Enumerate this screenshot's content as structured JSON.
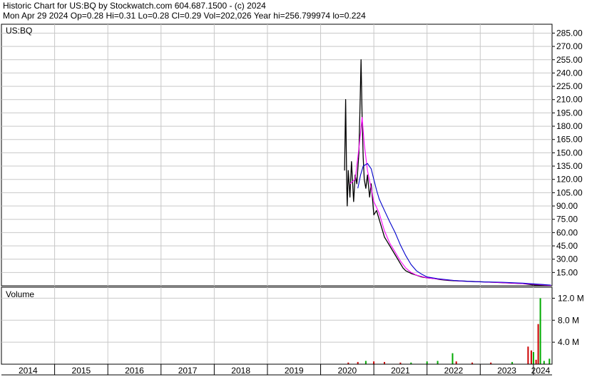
{
  "header": {
    "line1": "Historic Chart for US:BQ by Stockwatch.com 604.687.1500 - (c) 2024",
    "line2": "Mon Apr 29 2024   Op=0.28   Hi=0.31   Lo=0.28   Cl=0.29   Vol=202,026   Year hi=256.799974   lo=0.224"
  },
  "colors": {
    "price": "#000000",
    "ma_short": "#ff00ff",
    "ma_long": "#0000cc",
    "vol_down": "#cc0000",
    "vol_up": "#00aa00",
    "grid": "#c8c8c8"
  },
  "chart_data": [
    {
      "type": "line",
      "symbol_label": "US:BQ",
      "ylim": [
        0,
        295
      ],
      "yticks": [
        "15.00",
        "30.00",
        "45.00",
        "60.00",
        "75.00",
        "90.00",
        "105.00",
        "120.00",
        "135.00",
        "150.00",
        "165.00",
        "180.00",
        "195.00",
        "210.00",
        "225.00",
        "240.00",
        "255.00",
        "270.00",
        "285.00"
      ],
      "xticks": [
        "2014",
        "2015",
        "2016",
        "2017",
        "2018",
        "2019",
        "2020",
        "2021",
        "2022",
        "2023",
        "2024"
      ],
      "xlim": [
        2014.0,
        2024.35
      ],
      "grid": true,
      "series": [
        {
          "role": "price",
          "x": [
            2020.45,
            2020.47,
            2020.49,
            2020.5,
            2020.52,
            2020.55,
            2020.58,
            2020.62,
            2020.65,
            2020.68,
            2020.72,
            2020.74,
            2020.76,
            2020.78,
            2020.8,
            2020.82,
            2020.85,
            2020.88,
            2020.92,
            2020.95,
            2020.98,
            2021.0,
            2021.05,
            2021.1,
            2021.15,
            2021.2,
            2021.25,
            2021.3,
            2021.35,
            2021.4,
            2021.45,
            2021.5,
            2021.55,
            2021.6,
            2021.7,
            2021.8,
            2021.9,
            2022.0,
            2022.15,
            2022.25,
            2022.4,
            2022.6,
            2022.8,
            2023.0,
            2023.2,
            2023.4,
            2023.6,
            2023.8,
            2024.0,
            2024.15,
            2024.33
          ],
          "y": [
            130,
            210,
            115,
            90,
            130,
            100,
            140,
            95,
            125,
            115,
            150,
            200,
            255,
            190,
            145,
            120,
            110,
            125,
            100,
            115,
            95,
            80,
            85,
            75,
            65,
            55,
            50,
            45,
            40,
            35,
            30,
            25,
            20,
            17,
            14,
            12,
            10,
            9,
            8,
            7,
            6,
            5.5,
            5,
            4.5,
            4,
            3.5,
            3,
            2.5,
            1,
            0.5,
            0.29
          ]
        },
        {
          "role": "ma_short",
          "x": [
            2020.55,
            2020.65,
            2020.72,
            2020.78,
            2020.82,
            2020.88,
            2020.95,
            2021.0,
            2021.1,
            2021.2,
            2021.3,
            2021.4,
            2021.5,
            2021.6,
            2021.7,
            2021.8,
            2022.0,
            2022.3,
            2022.6,
            2023.0,
            2023.4,
            2023.8,
            2024.33
          ],
          "y": [
            115,
            120,
            155,
            190,
            160,
            130,
            110,
            95,
            82,
            62,
            48,
            38,
            28,
            20,
            15,
            12,
            9,
            7,
            5.5,
            4.5,
            3.5,
            2.5,
            0.4
          ]
        },
        {
          "role": "ma_long",
          "x": [
            2020.7,
            2020.75,
            2020.8,
            2020.88,
            2020.95,
            2021.0,
            2021.05,
            2021.1,
            2021.2,
            2021.3,
            2021.4,
            2021.5,
            2021.6,
            2021.7,
            2021.8,
            2021.9,
            2022.0,
            2022.2,
            2022.5,
            2022.8,
            2023.0,
            2023.4,
            2023.8,
            2024.33
          ],
          "y": [
            110,
            125,
            135,
            138,
            132,
            120,
            108,
            98,
            85,
            72,
            60,
            46,
            34,
            24,
            17,
            13,
            10,
            8,
            6,
            5,
            4.5,
            4,
            3,
            0.8
          ]
        }
      ]
    },
    {
      "type": "bar",
      "title": "Volume",
      "ylim": [
        0,
        14
      ],
      "yticks": [
        "4.0 M",
        "8.0 M",
        "12.0 M"
      ],
      "bars": [
        {
          "x": 2020.52,
          "v": 0.3,
          "dir": "down"
        },
        {
          "x": 2020.7,
          "v": 0.4,
          "dir": "down"
        },
        {
          "x": 2020.85,
          "v": 0.6,
          "dir": "up"
        },
        {
          "x": 2021.0,
          "v": 0.5,
          "dir": "down"
        },
        {
          "x": 2021.2,
          "v": 0.4,
          "dir": "down"
        },
        {
          "x": 2021.5,
          "v": 0.3,
          "dir": "down"
        },
        {
          "x": 2021.7,
          "v": 0.3,
          "dir": "up"
        },
        {
          "x": 2022.0,
          "v": 0.5,
          "dir": "up"
        },
        {
          "x": 2022.2,
          "v": 0.6,
          "dir": "up"
        },
        {
          "x": 2022.48,
          "v": 2.0,
          "dir": "up"
        },
        {
          "x": 2022.55,
          "v": 0.5,
          "dir": "down"
        },
        {
          "x": 2022.85,
          "v": 0.3,
          "dir": "down"
        },
        {
          "x": 2023.2,
          "v": 0.3,
          "dir": "down"
        },
        {
          "x": 2023.6,
          "v": 0.4,
          "dir": "up"
        },
        {
          "x": 2023.9,
          "v": 3.2,
          "dir": "down"
        },
        {
          "x": 2023.96,
          "v": 2.5,
          "dir": "down"
        },
        {
          "x": 2024.0,
          "v": 2.2,
          "dir": "up"
        },
        {
          "x": 2024.05,
          "v": 0.8,
          "dir": "down"
        },
        {
          "x": 2024.09,
          "v": 7.3,
          "dir": "down"
        },
        {
          "x": 2024.13,
          "v": 12.0,
          "dir": "up"
        },
        {
          "x": 2024.2,
          "v": 0.6,
          "dir": "up"
        },
        {
          "x": 2024.3,
          "v": 1.0,
          "dir": "up"
        }
      ]
    }
  ]
}
